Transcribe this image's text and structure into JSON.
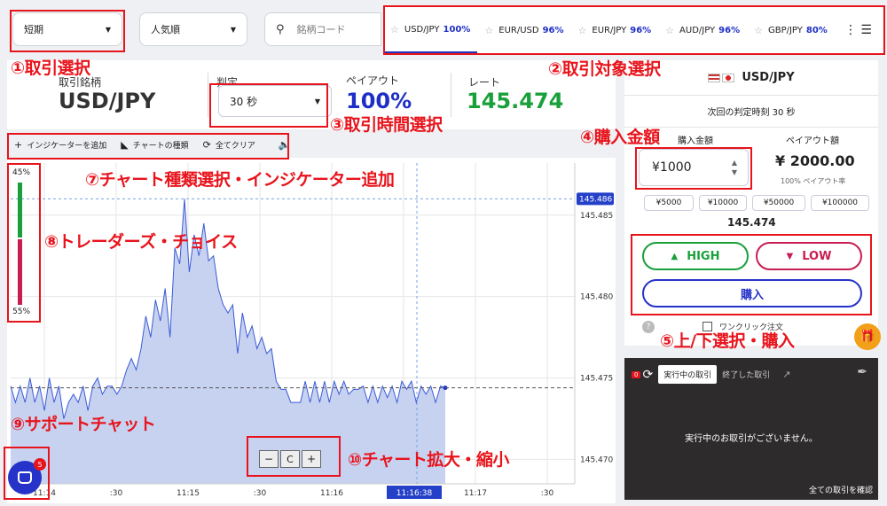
{
  "topbar": {
    "trade_type": "短期",
    "sort": "人気順",
    "search_placeholder": "銘柄コード",
    "tabs": [
      {
        "pair": "USD/JPY",
        "payout": "100%"
      },
      {
        "pair": "EUR/USD",
        "payout": "96%"
      },
      {
        "pair": "EUR/JPY",
        "payout": "96%"
      },
      {
        "pair": "AUD/JPY",
        "payout": "96%"
      },
      {
        "pair": "GBP/JPY",
        "payout": "80%"
      }
    ]
  },
  "info": {
    "symbol_label": "取引銘柄",
    "symbol": "USD/JPY",
    "judge_label": "判定",
    "duration": "30 秒",
    "payout_label": "ペイアウト",
    "payout": "100%",
    "rate_label": "レート",
    "rate": "145.474"
  },
  "charttools": {
    "add_indicator": "インジケーターを追加",
    "chart_type": "チャートの種類",
    "clear_all": "全てクリア"
  },
  "sentiment": {
    "top": "45%",
    "bottom": "55%"
  },
  "chart_data": {
    "type": "area",
    "y_ticks": [
      "145.485",
      "145.480",
      "145.475",
      "145.470"
    ],
    "ylim": [
      145.4685,
      145.4882
    ],
    "x_ticks": [
      "11:14",
      ":30",
      "11:15",
      ":30",
      "11:16",
      ":30",
      "11:17",
      ":30"
    ],
    "current_time": "11:16:38",
    "high_price_tag": "145.486",
    "reference_level": 145.4744,
    "values": [
      145.4745,
      145.4735,
      145.4745,
      145.4735,
      145.475,
      145.4735,
      145.4745,
      145.473,
      145.475,
      145.4735,
      145.4745,
      145.4725,
      145.4735,
      145.474,
      145.4735,
      145.4745,
      145.473,
      145.4745,
      145.475,
      145.474,
      145.4745,
      145.4745,
      145.474,
      145.4745,
      145.4755,
      145.4762,
      145.4755,
      145.4768,
      145.4788,
      145.4775,
      145.4798,
      145.4785,
      145.4805,
      145.4775,
      145.483,
      145.482,
      145.486,
      145.4815,
      145.4838,
      145.4825,
      145.4845,
      145.4822,
      145.4825,
      145.4805,
      145.4795,
      145.479,
      145.4795,
      145.4765,
      145.479,
      145.4775,
      145.4782,
      145.4768,
      145.4775,
      145.4765,
      145.4768,
      145.4748,
      145.4743,
      145.4743,
      145.4735,
      145.4735,
      145.4735,
      145.4748,
      145.4735,
      145.4748,
      145.4735,
      145.4748,
      145.4735,
      145.4748,
      145.474,
      145.4748,
      145.474,
      145.4743,
      145.4743,
      145.4745,
      145.4735,
      145.4745,
      145.4735,
      145.4745,
      145.4738,
      145.4745,
      145.4735,
      145.4748,
      145.4743,
      145.4748,
      145.4735,
      145.4745,
      145.474,
      145.4745,
      145.4735,
      145.4745,
      145.4744
    ]
  },
  "zoom": {
    "minus": "−",
    "reset": "C",
    "plus": "+"
  },
  "order": {
    "pair": "USD/JPY",
    "next_judge": "次回の判定時刻 30 秒",
    "amount_label": "購入金額",
    "amount": "¥1000",
    "payout_label": "ペイアウト額",
    "payout_amount": "¥ 2000.00",
    "payout_rate": "100% ペイアウト率",
    "quick_amounts": [
      "¥5000",
      "¥10000",
      "¥50000",
      "¥100000"
    ],
    "rate": "145.474",
    "high": "HIGH",
    "low": "LOW",
    "buy": "購入",
    "oneclick": "ワンクリック注文"
  },
  "trades": {
    "badge": "0",
    "active_tab": "実行中の取引",
    "closed_tab": "終了した取引",
    "empty": "実行中のお取引がございません。",
    "all_link": "全ての取引を確認"
  },
  "chat": {
    "badge": "5"
  },
  "annotations": {
    "a1": "①取引選択",
    "a2": "②取引対象選択",
    "a3": "③取引時間選択",
    "a4": "④購入金額",
    "a5": "⑤上/下選択・購入",
    "a7": "⑦チャート種類選択・インジケーター追加",
    "a8": "⑧トレーダーズ・チョイス",
    "a9": "⑨サポートチャット",
    "a10": "⑩チャート拡大・縮小"
  },
  "colors": {
    "accent": "#2533c9",
    "high": "#19a03a",
    "low": "#c81d51",
    "annotation": "#e8141c",
    "rate": "#19a03a"
  }
}
